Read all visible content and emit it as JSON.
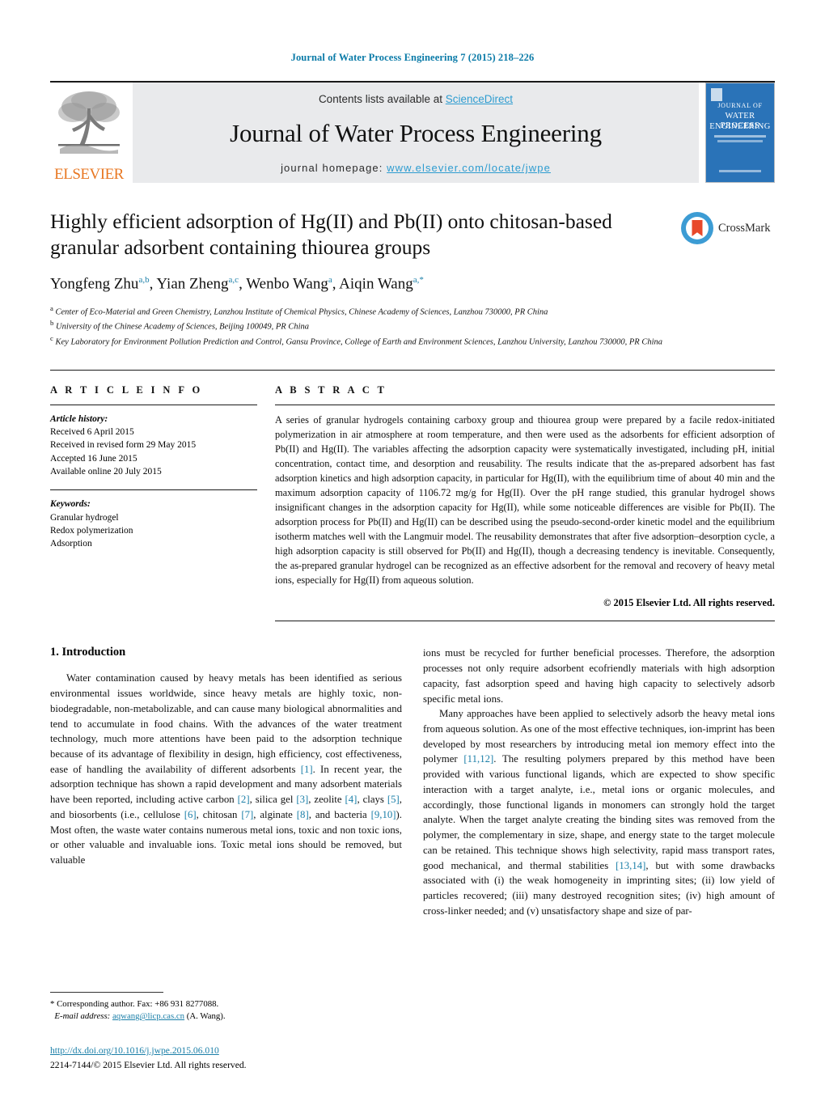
{
  "running_head": "Journal of Water Process Engineering 7 (2015) 218–226",
  "masthead": {
    "contents_prefix": "Contents lists available at ",
    "sciencedirect": "ScienceDirect",
    "journal_title": "Journal of Water Process Engineering",
    "homepage_prefix": "journal homepage: ",
    "homepage_url": "www.elsevier.com/locate/jwpe",
    "elsevier_wordmark": "ELSEVIER",
    "cover": {
      "line1": "JOURNAL OF",
      "line2": "WATER PROCESS",
      "line3": "ENGINEERING"
    }
  },
  "article": {
    "title": "Highly efficient adsorption of Hg(II) and Pb(II) onto chitosan-based granular adsorbent containing thiourea groups",
    "authors_html": "Yongfeng Zhu<sup>a,b</sup>, Yian Zheng<sup>a,c</sup>, Wenbo Wang<sup>a</sup>, Aiqin Wang<sup>a,</sup><sup>*</sup>",
    "crossmark_label": "CrossMark",
    "affiliations": [
      "Center of Eco-Material and Green Chemistry, Lanzhou Institute of Chemical Physics, Chinese Academy of Sciences, Lanzhou 730000, PR China",
      "University of the Chinese Academy of Sciences, Beijing 100049, PR China",
      "Key Laboratory for Environment Pollution Prediction and Control, Gansu Province, College of Earth and Environment Sciences, Lanzhou University, Lanzhou 730000, PR China"
    ],
    "affiliation_marks": [
      "a",
      "b",
      "c"
    ]
  },
  "article_info": {
    "heading": "A R T I C L E   I N F O",
    "history_label": "Article history:",
    "history": [
      "Received 6 April 2015",
      "Received in revised form 29 May 2015",
      "Accepted 16 June 2015",
      "Available online 20 July 2015"
    ],
    "keywords_label": "Keywords:",
    "keywords": [
      "Granular hydrogel",
      "Redox polymerization",
      "Adsorption"
    ]
  },
  "abstract": {
    "heading": "A B S T R A C T",
    "text": "A series of granular hydrogels containing carboxy group and thiourea group were prepared by a facile redox-initiated polymerization in air atmosphere at room temperature, and then were used as the adsorbents for efficient adsorption of Pb(II) and Hg(II). The variables affecting the adsorption capacity were systematically investigated, including pH, initial concentration, contact time, and desorption and reusability. The results indicate that the as-prepared adsorbent has fast adsorption kinetics and high adsorption capacity, in particular for Hg(II), with the equilibrium time of about 40 min and the maximum adsorption capacity of 1106.72 mg/g for Hg(II). Over the pH range studied, this granular hydrogel shows insignificant changes in the adsorption capacity for Hg(II), while some noticeable differences are visible for Pb(II). The adsorption process for Pb(II) and Hg(II) can be described using the pseudo-second-order kinetic model and the equilibrium isotherm matches well with the Langmuir model. The reusability demonstrates that after five adsorption–desorption cycle, a high adsorption capacity is still observed for Pb(II) and Hg(II), though a decreasing tendency is inevitable. Consequently, the as-prepared granular hydrogel can be recognized as an effective adsorbent for the removal and recovery of heavy metal ions, especially for Hg(II) from aqueous solution.",
    "copyright": "© 2015 Elsevier Ltd. All rights reserved."
  },
  "body": {
    "section_number_title": "1.  Introduction",
    "left_para_1_html": "Water contamination caused by heavy metals has been identified as serious environmental issues worldwide, since heavy metals are highly toxic, non-biodegradable, non-metabolizable, and can cause many biological abnormalities and tend to accumulate in food chains. With the advances of the water treatment technology, much more attentions have been paid to the adsorption technique because of its advantage of flexibility in design, high efficiency, cost effectiveness, ease of handling the availability of different adsorbents <span class=\"ref\">[1]</span>. In recent year, the adsorption technique has shown a rapid development and many adsorbent materials have been reported, including active carbon <span class=\"ref\">[2]</span>, silica gel <span class=\"ref\">[3]</span>, zeolite <span class=\"ref\">[4]</span>, clays <span class=\"ref\">[5]</span>, and biosorbents (i.e., cellulose <span class=\"ref\">[6]</span>, chitosan <span class=\"ref\">[7]</span>, alginate <span class=\"ref\">[8]</span>, and bacteria <span class=\"ref\">[9,10]</span>). Most often, the waste water contains numerous metal ions, toxic and non toxic ions, or other valuable and invaluable ions. Toxic metal ions should be removed, but valuable",
    "right_para_1_html": "ions must be recycled for further beneficial processes. Therefore, the adsorption processes not only require adsorbent ecofriendly materials with high adsorption capacity, fast adsorption speed and having high capacity to selectively adsorb specific metal ions.",
    "right_para_2_html": "Many approaches have been applied to selectively adsorb the heavy metal ions from aqueous solution. As one of the most effective techniques, ion-imprint has been developed by most researchers by introducing metal ion memory effect into the polymer <span class=\"ref\">[11,12]</span>. The resulting polymers prepared by this method have been provided with various functional ligands, which are expected to show specific interaction with a target analyte, i.e., metal ions or organic molecules, and accordingly, those functional ligands in monomers can strongly hold the target analyte. When the target analyte creating the binding sites was removed from the polymer, the complementary in size, shape, and energy state to the target molecule can be retained. This technique shows high selectivity, rapid mass transport rates, good mechanical, and thermal stabilities <span class=\"ref\">[13,14]</span>, but with some drawbacks associated with (i) the weak homogeneity in imprinting sites; (ii) low yield of particles recovered; (iii) many destroyed recognition sites; (iv) high amount of cross-linker needed; and (v) unsatisfactory shape and size of par-"
  },
  "footnote": {
    "corresponding": "*  Corresponding author. Fax: +86 931 8277088.",
    "email_label": "E-mail address:",
    "email": "aqwang@licp.cas.cn",
    "email_suffix": " (A. Wang).",
    "doi": "http://dx.doi.org/10.1016/j.jwpe.2015.06.010",
    "issn_line": "2214-7144/© 2015 Elsevier Ltd. All rights reserved."
  }
}
